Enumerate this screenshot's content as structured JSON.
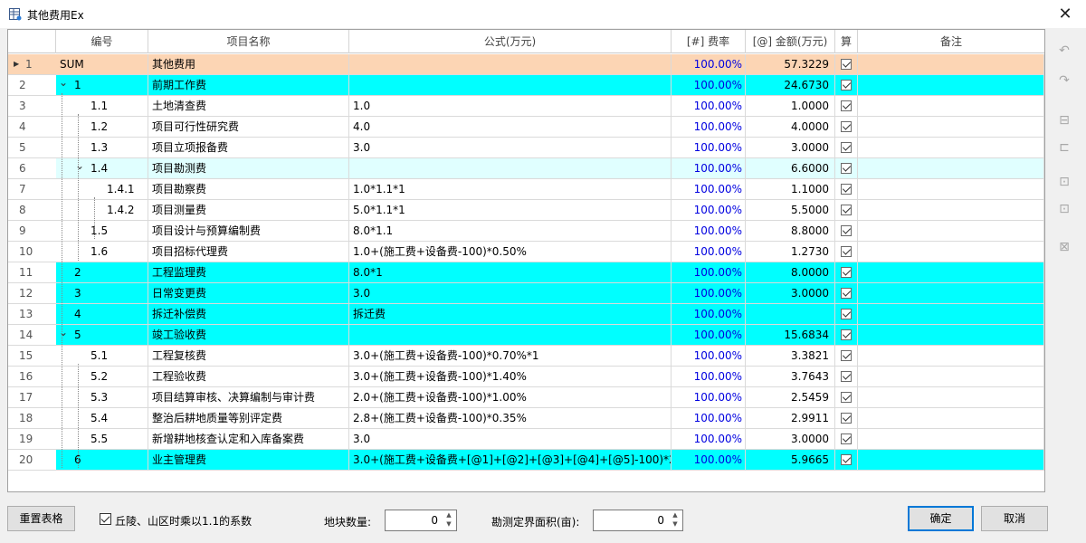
{
  "window": {
    "title": "其他费用Ex",
    "close_glyph": "✕"
  },
  "grid": {
    "headers": [
      "编号",
      "项目名称",
      "公式(万元)",
      "[#] 费率",
      "[@] 金额(万元)",
      "算",
      "备注"
    ],
    "rows": [
      {
        "idx": "1",
        "code": "SUM",
        "name": "其他费用",
        "formula": "",
        "rate": "100.00%",
        "amount": "57.3229",
        "calc": true,
        "note": "",
        "style": "sum",
        "level": 0,
        "toggle": "⌄"
      },
      {
        "idx": "2",
        "code": "1",
        "name": "前期工作费",
        "formula": "",
        "rate": "100.00%",
        "amount": "24.6730",
        "calc": true,
        "note": "",
        "style": "cyan",
        "level": 1,
        "toggle": "⌄"
      },
      {
        "idx": "3",
        "code": "1.1",
        "name": "土地清查费",
        "formula": "1.0",
        "rate": "100.00%",
        "amount": "1.0000",
        "calc": true,
        "note": "",
        "style": "",
        "level": 2
      },
      {
        "idx": "4",
        "code": "1.2",
        "name": "项目可行性研究费",
        "formula": "4.0",
        "rate": "100.00%",
        "amount": "4.0000",
        "calc": true,
        "note": "",
        "style": "",
        "level": 2
      },
      {
        "idx": "5",
        "code": "1.3",
        "name": "项目立项报备费",
        "formula": "3.0",
        "rate": "100.00%",
        "amount": "3.0000",
        "calc": true,
        "note": "",
        "style": "",
        "level": 2
      },
      {
        "idx": "6",
        "code": "1.4",
        "name": "项目勘测费",
        "formula": "",
        "rate": "100.00%",
        "amount": "6.6000",
        "calc": true,
        "note": "",
        "style": "light",
        "level": 2,
        "toggle": "⌄"
      },
      {
        "idx": "7",
        "code": "1.4.1",
        "name": "项目勘察费",
        "formula": "1.0*1.1*1",
        "rate": "100.00%",
        "amount": "1.1000",
        "calc": true,
        "note": "",
        "style": "",
        "level": 3
      },
      {
        "idx": "8",
        "code": "1.4.2",
        "name": "项目测量费",
        "formula": "5.0*1.1*1",
        "rate": "100.00%",
        "amount": "5.5000",
        "calc": true,
        "note": "",
        "style": "",
        "level": 3
      },
      {
        "idx": "9",
        "code": "1.5",
        "name": "项目设计与预算编制费",
        "formula": "8.0*1.1",
        "rate": "100.00%",
        "amount": "8.8000",
        "calc": true,
        "note": "",
        "style": "",
        "level": 2
      },
      {
        "idx": "10",
        "code": "1.6",
        "name": "项目招标代理费",
        "formula": "1.0+(施工费+设备费-100)*0.50%",
        "rate": "100.00%",
        "amount": "1.2730",
        "calc": true,
        "note": "",
        "style": "",
        "level": 2
      },
      {
        "idx": "11",
        "code": "2",
        "name": "工程监理费",
        "formula": "8.0*1",
        "rate": "100.00%",
        "amount": "8.0000",
        "calc": true,
        "note": "",
        "style": "cyan",
        "level": 1
      },
      {
        "idx": "12",
        "code": "3",
        "name": "日常变更费",
        "formula": "3.0",
        "rate": "100.00%",
        "amount": "3.0000",
        "calc": true,
        "note": "",
        "style": "cyan",
        "level": 1
      },
      {
        "idx": "13",
        "code": "4",
        "name": "拆迁补偿费",
        "formula": "拆迁费",
        "rate": "100.00%",
        "amount": "",
        "calc": true,
        "note": "",
        "style": "cyan",
        "level": 1
      },
      {
        "idx": "14",
        "code": "5",
        "name": "竣工验收费",
        "formula": "",
        "rate": "100.00%",
        "amount": "15.6834",
        "calc": true,
        "note": "",
        "style": "cyan",
        "level": 1,
        "toggle": "⌄"
      },
      {
        "idx": "15",
        "code": "5.1",
        "name": "工程复核费",
        "formula": "3.0+(施工费+设备费-100)*0.70%*1",
        "rate": "100.00%",
        "amount": "3.3821",
        "calc": true,
        "note": "",
        "style": "",
        "level": 2
      },
      {
        "idx": "16",
        "code": "5.2",
        "name": "工程验收费",
        "formula": "3.0+(施工费+设备费-100)*1.40%",
        "rate": "100.00%",
        "amount": "3.7643",
        "calc": true,
        "note": "",
        "style": "",
        "level": 2
      },
      {
        "idx": "17",
        "code": "5.3",
        "name": "项目结算审核、决算编制与审计费",
        "formula": "2.0+(施工费+设备费-100)*1.00%",
        "rate": "100.00%",
        "amount": "2.5459",
        "calc": true,
        "note": "",
        "style": "",
        "level": 2
      },
      {
        "idx": "18",
        "code": "5.4",
        "name": "整治后耕地质量等别评定费",
        "formula": "2.8+(施工费+设备费-100)*0.35%",
        "rate": "100.00%",
        "amount": "2.9911",
        "calc": true,
        "note": "",
        "style": "",
        "level": 2
      },
      {
        "idx": "19",
        "code": "5.5",
        "name": "新增耕地核查认定和入库备案费",
        "formula": "3.0",
        "rate": "100.00%",
        "amount": "3.0000",
        "calc": true,
        "note": "",
        "style": "",
        "level": 2
      },
      {
        "idx": "20",
        "code": "6",
        "name": "业主管理费",
        "formula": "3.0+(施工费+设备费+[@1]+[@2]+[@3]+[@4]+[@5]-100)*2....",
        "rate": "100.00%",
        "amount": "5.9665",
        "calc": true,
        "note": "",
        "style": "cyan",
        "level": 1
      }
    ]
  },
  "side_toolbar": [
    "undo-icon",
    "redo-icon",
    "insert-row-icon",
    "insert-child-icon",
    "move-up-icon",
    "move-down-icon",
    "delete-row-icon"
  ],
  "bottom": {
    "reset_label": "重置表格",
    "hill_checkbox_label": "丘陵、山区时乘以1.1的系数",
    "hill_checked": true,
    "parcel_label": "地块数量:",
    "parcel_value": "0",
    "area_label": "勘测定界面积(亩):",
    "area_value": "0",
    "ok_label": "确定",
    "cancel_label": "取消"
  }
}
